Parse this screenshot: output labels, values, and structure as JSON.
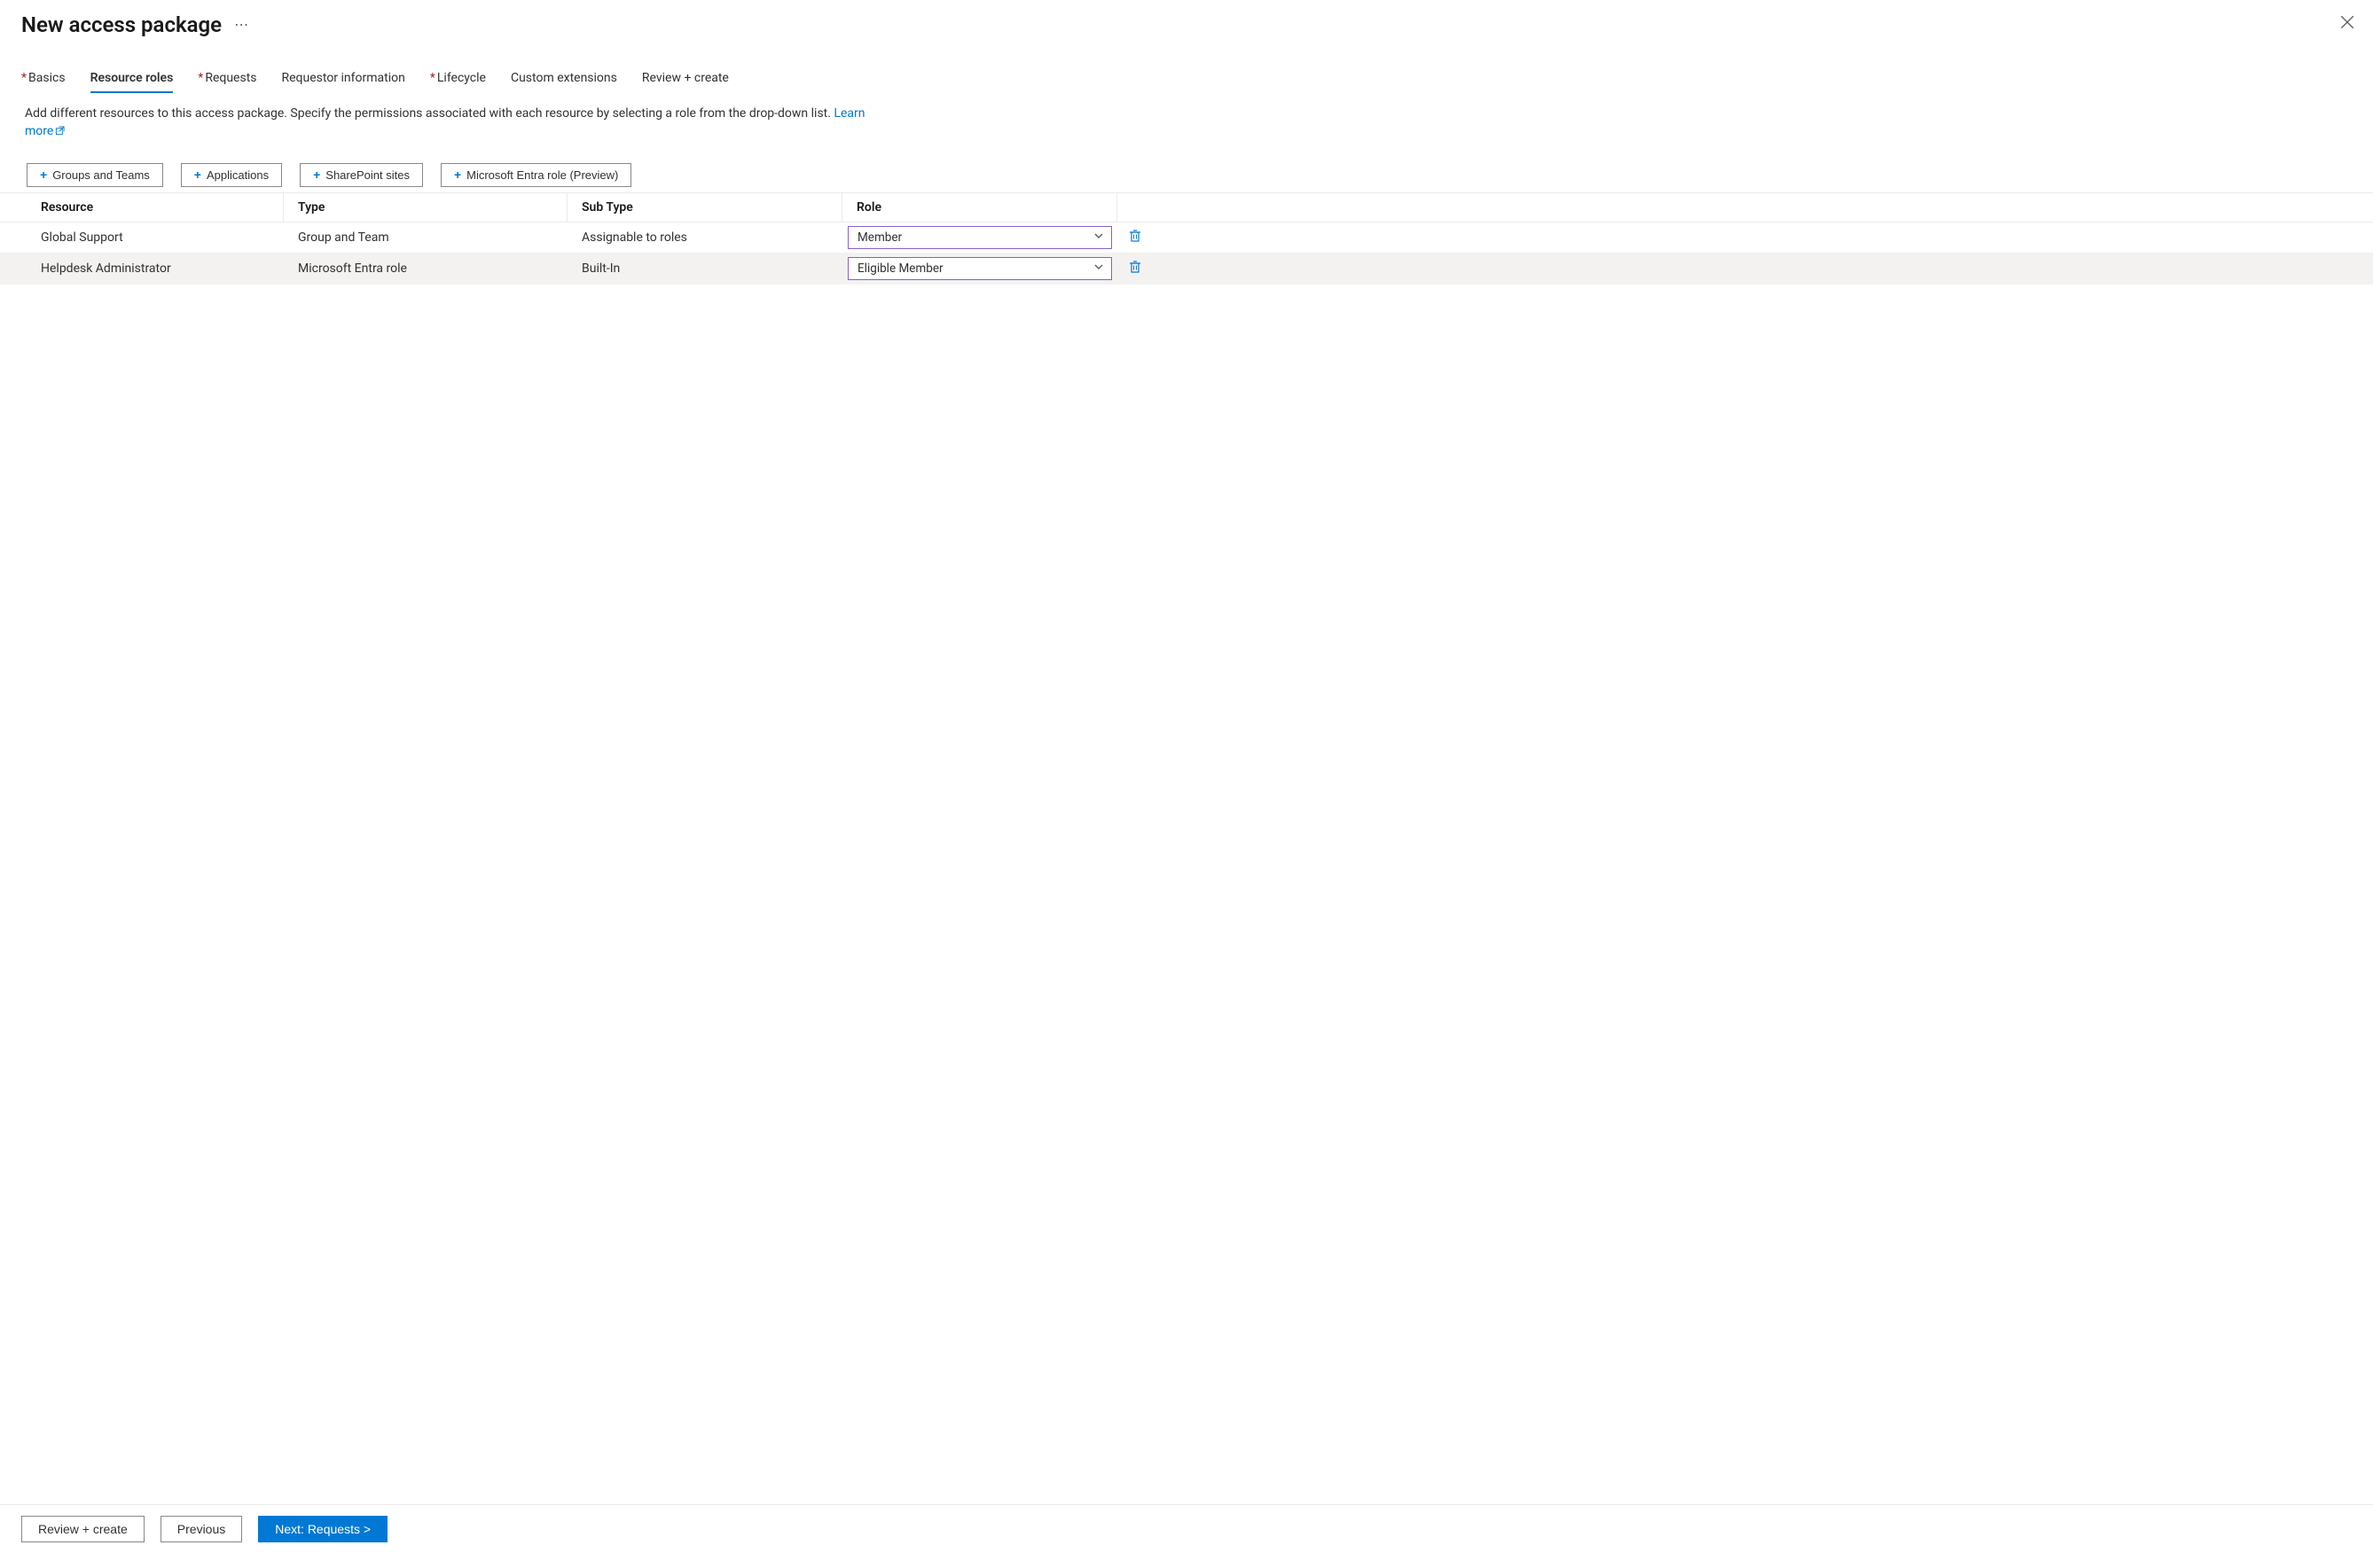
{
  "header": {
    "title": "New access package"
  },
  "tabs": [
    {
      "label": "Basics",
      "required": true,
      "active": false
    },
    {
      "label": "Resource roles",
      "required": false,
      "active": true
    },
    {
      "label": "Requests",
      "required": true,
      "active": false
    },
    {
      "label": "Requestor information",
      "required": false,
      "active": false
    },
    {
      "label": "Lifecycle",
      "required": true,
      "active": false
    },
    {
      "label": "Custom extensions",
      "required": false,
      "active": false
    },
    {
      "label": "Review + create",
      "required": false,
      "active": false
    }
  ],
  "description": {
    "text": "Add different resources to this access package. Specify the permissions associated with each resource by selecting a role from the drop-down list. ",
    "learn_more_label": "Learn more"
  },
  "add_buttons": [
    {
      "label": "Groups and Teams"
    },
    {
      "label": "Applications"
    },
    {
      "label": "SharePoint sites"
    },
    {
      "label": "Microsoft Entra role (Preview)"
    }
  ],
  "table": {
    "headers": {
      "resource": "Resource",
      "type": "Type",
      "subtype": "Sub Type",
      "role": "Role"
    },
    "rows": [
      {
        "resource": "Global Support",
        "type": "Group and Team",
        "subtype": "Assignable to roles",
        "role": "Member"
      },
      {
        "resource": "Helpdesk Administrator",
        "type": "Microsoft Entra role",
        "subtype": "Built-In",
        "role": "Eligible Member"
      }
    ]
  },
  "footer": {
    "review_label": "Review + create",
    "previous_label": "Previous",
    "next_label": "Next: Requests >"
  }
}
